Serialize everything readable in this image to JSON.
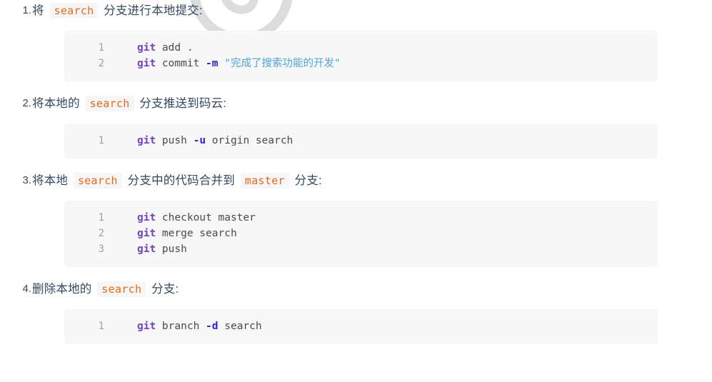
{
  "document": {
    "type": "git-workflow-instructions",
    "language": "zh-CN",
    "watermark": {
      "name": "circular-logo-watermark",
      "color": "#8a8f95"
    },
    "colors": {
      "text": "#34495e",
      "inline_code_text": "#e8681a",
      "inline_code_bg": "#f6f6f6",
      "code_block_bg": "#f7f7f8",
      "line_number": "#9aa0a6",
      "token_command": "#6f42c1",
      "token_plain": "#4a4a4a",
      "token_flag": "#2727d8",
      "token_string": "#4fa6d8"
    }
  },
  "steps": [
    {
      "marker": "1.",
      "text_parts": [
        {
          "kind": "text",
          "value": "将 "
        },
        {
          "kind": "code",
          "value": "search"
        },
        {
          "kind": "text",
          "value": " 分支进行本地提交:"
        }
      ],
      "plain_text": "将 search 分支进行本地提交:",
      "code": {
        "lines": [
          {
            "number": "1",
            "raw": "git add .",
            "tokens": [
              {
                "type": "cmd",
                "value": "git"
              },
              {
                "type": "plain",
                "value": " add ."
              }
            ]
          },
          {
            "number": "2",
            "raw": "git commit -m \"完成了搜索功能的开发\"",
            "tokens": [
              {
                "type": "cmd",
                "value": "git"
              },
              {
                "type": "plain",
                "value": " commit "
              },
              {
                "type": "flag",
                "value": "-m"
              },
              {
                "type": "plain",
                "value": " "
              },
              {
                "type": "string",
                "value": "\"完成了搜索功能的开发\""
              }
            ]
          }
        ]
      }
    },
    {
      "marker": "2.",
      "text_parts": [
        {
          "kind": "text",
          "value": "将本地的 "
        },
        {
          "kind": "code",
          "value": "search"
        },
        {
          "kind": "text",
          "value": " 分支推送到码云:"
        }
      ],
      "plain_text": "将本地的 search 分支推送到码云:",
      "code": {
        "lines": [
          {
            "number": "1",
            "raw": "git push -u origin search",
            "tokens": [
              {
                "type": "cmd",
                "value": "git"
              },
              {
                "type": "plain",
                "value": " push "
              },
              {
                "type": "flag",
                "value": "-u"
              },
              {
                "type": "plain",
                "value": " origin search"
              }
            ]
          }
        ]
      }
    },
    {
      "marker": "3.",
      "text_parts": [
        {
          "kind": "text",
          "value": "将本地 "
        },
        {
          "kind": "code",
          "value": "search"
        },
        {
          "kind": "text",
          "value": " 分支中的代码合并到 "
        },
        {
          "kind": "code",
          "value": "master"
        },
        {
          "kind": "text",
          "value": " 分支:"
        }
      ],
      "plain_text": "将本地 search 分支中的代码合并到 master 分支:",
      "code": {
        "lines": [
          {
            "number": "1",
            "raw": "git checkout master",
            "tokens": [
              {
                "type": "cmd",
                "value": "git"
              },
              {
                "type": "plain",
                "value": " checkout master"
              }
            ]
          },
          {
            "number": "2",
            "raw": "git merge search",
            "tokens": [
              {
                "type": "cmd",
                "value": "git"
              },
              {
                "type": "plain",
                "value": " merge search"
              }
            ]
          },
          {
            "number": "3",
            "raw": "git push",
            "tokens": [
              {
                "type": "cmd",
                "value": "git"
              },
              {
                "type": "plain",
                "value": " push"
              }
            ]
          }
        ]
      }
    },
    {
      "marker": "4.",
      "text_parts": [
        {
          "kind": "text",
          "value": "删除本地的 "
        },
        {
          "kind": "code",
          "value": "search"
        },
        {
          "kind": "text",
          "value": " 分支:"
        }
      ],
      "plain_text": "删除本地的 search 分支:",
      "code": {
        "lines": [
          {
            "number": "1",
            "raw": "git branch -d search",
            "tokens": [
              {
                "type": "cmd",
                "value": "git"
              },
              {
                "type": "plain",
                "value": " branch "
              },
              {
                "type": "flag",
                "value": "-d"
              },
              {
                "type": "plain",
                "value": " search"
              }
            ]
          }
        ]
      }
    }
  ]
}
